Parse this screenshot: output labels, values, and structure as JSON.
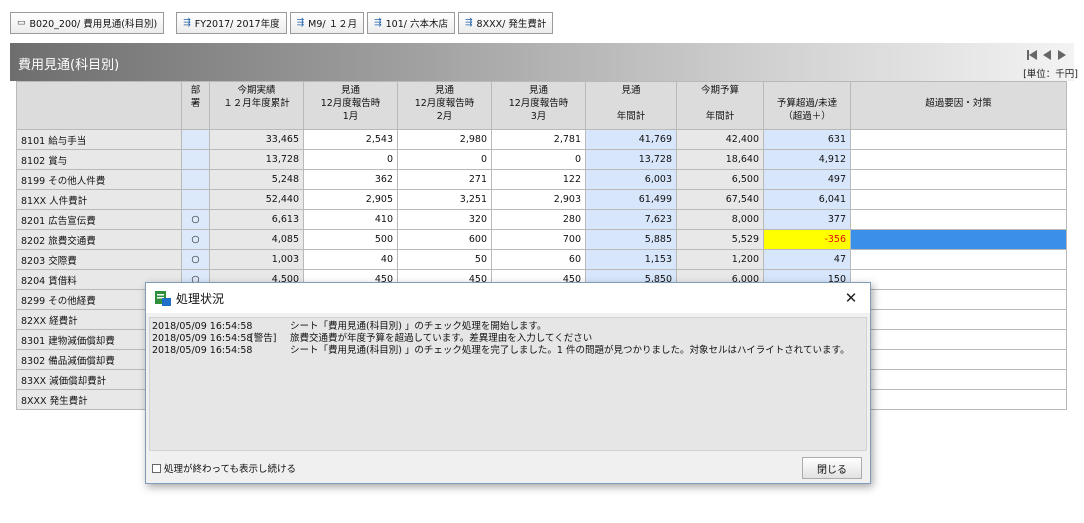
{
  "filters": {
    "sheet": "B020_200/ 費用見通(科目別)",
    "year": "FY2017/ 2017年度",
    "month": "M9/ １２月",
    "store": "101/ 六本木店",
    "account": "8XXX/ 発生費計"
  },
  "title": "費用見通(科目別)",
  "unit": "[単位：千円]",
  "table": {
    "headers": {
      "dept": [
        "部",
        "署"
      ],
      "actual": [
        "今期実績",
        "",
        "１２月年度累計"
      ],
      "m1": [
        "見通",
        "12月度報告時",
        "1月"
      ],
      "m2": [
        "見通",
        "12月度報告時",
        "2月"
      ],
      "m3": [
        "見通",
        "12月度報告時",
        "3月"
      ],
      "forecast": [
        "見通",
        "",
        "年間計"
      ],
      "budget": [
        "今期予算",
        "",
        "年間計"
      ],
      "over": [
        "",
        "予算超過/未達",
        "（超過＋）"
      ],
      "reason": [
        "",
        "超過要因・対策",
        ""
      ]
    },
    "rows": [
      {
        "label": "8101 給与手当",
        "dept": "",
        "actual": "33,465",
        "m1": "2,543",
        "m2": "2,980",
        "m3": "2,781",
        "forecast": "41,769",
        "budget": "42,400",
        "over": "631"
      },
      {
        "label": "8102 賞与",
        "dept": "",
        "actual": "13,728",
        "m1": "0",
        "m2": "0",
        "m3": "0",
        "forecast": "13,728",
        "budget": "18,640",
        "over": "4,912"
      },
      {
        "label": "8199 その他人件費",
        "dept": "",
        "actual": "5,248",
        "m1": "362",
        "m2": "271",
        "m3": "122",
        "forecast": "6,003",
        "budget": "6,500",
        "over": "497"
      },
      {
        "label": "81XX 人件費計",
        "dept": "",
        "actual": "52,440",
        "m1": "2,905",
        "m2": "3,251",
        "m3": "2,903",
        "forecast": "61,499",
        "budget": "67,540",
        "over": "6,041"
      },
      {
        "label": "8201 広告宣伝費",
        "dept": "○",
        "actual": "6,613",
        "m1": "410",
        "m2": "320",
        "m3": "280",
        "forecast": "7,623",
        "budget": "8,000",
        "over": "377"
      },
      {
        "label": "8202 旅費交通費",
        "dept": "○",
        "actual": "4,085",
        "m1": "500",
        "m2": "600",
        "m3": "700",
        "forecast": "5,885",
        "budget": "5,529",
        "over": "-356"
      },
      {
        "label": "8203 交際費",
        "dept": "○",
        "actual": "1,003",
        "m1": "40",
        "m2": "50",
        "m3": "60",
        "forecast": "1,153",
        "budget": "1,200",
        "over": "47"
      },
      {
        "label": "8204 賃借料",
        "dept": "○",
        "actual": "4,500",
        "m1": "450",
        "m2": "450",
        "m3": "450",
        "forecast": "5,850",
        "budget": "6,000",
        "over": "150"
      },
      {
        "label": "8299 その他経費",
        "dept": "",
        "actual": "",
        "m1": "",
        "m2": "",
        "m3": "",
        "forecast": "",
        "budget": "",
        "over": ""
      },
      {
        "label": "82XX 経費計",
        "dept": "",
        "actual": "",
        "m1": "",
        "m2": "",
        "m3": "",
        "forecast": "",
        "budget": "",
        "over": ""
      },
      {
        "label": "8301 建物減価償却費",
        "dept": "",
        "actual": "",
        "m1": "",
        "m2": "",
        "m3": "",
        "forecast": "",
        "budget": "",
        "over": ""
      },
      {
        "label": "8302 備品減価償却費",
        "dept": "",
        "actual": "",
        "m1": "",
        "m2": "",
        "m3": "",
        "forecast": "",
        "budget": "",
        "over": ""
      },
      {
        "label": "83XX 減価償却費計",
        "dept": "",
        "actual": "",
        "m1": "",
        "m2": "",
        "m3": "",
        "forecast": "",
        "budget": "",
        "over": ""
      },
      {
        "label": "8XXX 発生費計",
        "dept": "",
        "actual": "",
        "m1": "",
        "m2": "",
        "m3": "",
        "forecast": "",
        "budget": "",
        "over": ""
      }
    ]
  },
  "dialog": {
    "title": "処理状況",
    "log": [
      {
        "time": "2018/05/09 16:54:58",
        "level": "",
        "message": "シート「費用見通(科目別) 」のチェック処理を開始します。"
      },
      {
        "time": "2018/05/09 16:54:58",
        "level": "[警告]",
        "message": "旅費交通費が年度予算を超過しています。差異理由を入力してください"
      },
      {
        "time": "2018/05/09 16:54:58",
        "level": "",
        "message": "シート「費用見通(科目別) 」のチェック処理を完了しました。1 件の問題が見つかりました。対象セルはハイライトされています。"
      }
    ],
    "keep_label": "処理が終わっても表示し続ける",
    "close_label": "閉じる"
  },
  "colors": {
    "warning_cell": "#ffff00",
    "selected_cell": "#3a8fe8",
    "header_band": "#6e6e6e"
  }
}
